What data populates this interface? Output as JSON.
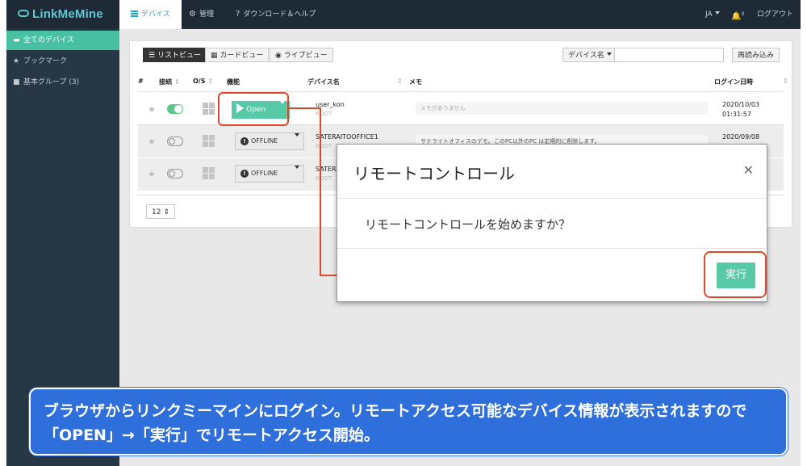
{
  "app": {
    "logo": "LinkMeMine"
  },
  "topnav": {
    "devices": "デバイス",
    "admin": "管理",
    "help": "ダウンロード＆ヘルプ",
    "lang": "JA",
    "notif_count": "0",
    "logout": "ログアウト"
  },
  "sidebar": {
    "items": [
      {
        "label": "全てのデバイス"
      },
      {
        "label": "ブックマーク"
      },
      {
        "label": "基本グループ (3)"
      }
    ]
  },
  "toolbar": {
    "list_view": "リストビュー",
    "card_view": "カードビュー",
    "live_view": "ライブビュー",
    "filter": "デバイス名",
    "reload": "再読み込み"
  },
  "table": {
    "headers": {
      "num": "#",
      "conn": "接続",
      "os": "O/S",
      "func": "機能",
      "name": "デバイス名",
      "memo": "メモ",
      "login": "ログイン日時"
    },
    "rows": [
      {
        "open_label": "Open",
        "name": "user_kon",
        "sub": "ROOT",
        "memo": "メモがありません",
        "date": "2020/10/03",
        "time": "01:31:57"
      },
      {
        "offline_label": "OFFLINE",
        "name": "SATERAITOOFFICE1",
        "sub": "ROOT",
        "memo": "サテライトオフィスのデモ。このPC以外のPC は定期的に削除します。",
        "date": "2020/09/08",
        "time": ""
      },
      {
        "offline_label": "OFFLINE",
        "name": "SATERAI",
        "sub": "ROOT"
      }
    ]
  },
  "pagination": {
    "per_page": "12"
  },
  "modal": {
    "title": "リモートコントロール",
    "message": "リモートコントロールを始めますか？",
    "confirm": "実行"
  },
  "caption": {
    "text": "ブラウザからリンクミーマインにログイン。リモートアクセス可能なデバイス情報が表示されますので「OPEN」→「実行」でリモートアクセス開始。"
  },
  "colors": {
    "accent": "#57c9a7",
    "highlight": "#e0472d",
    "caption_bg": "#2f6fdb",
    "nav_bg": "#1f2a37"
  }
}
